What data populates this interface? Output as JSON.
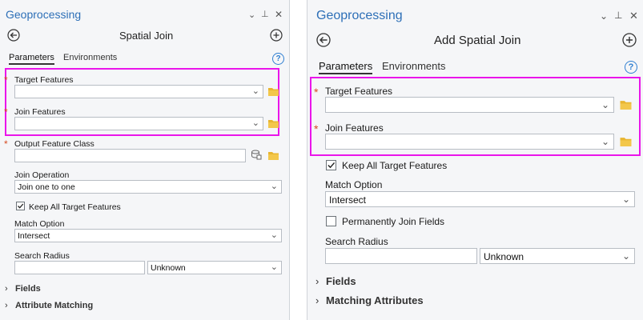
{
  "left": {
    "header": {
      "title": "Geoprocessing",
      "chevron": "⌄",
      "pin": "⊥",
      "close": "✕"
    },
    "tool": {
      "name": "Spatial Join"
    },
    "tabs": {
      "parameters": "Parameters",
      "environments": "Environments",
      "help": "?"
    },
    "target_features": {
      "label": "Target Features",
      "value": ""
    },
    "join_features": {
      "label": "Join Features",
      "value": ""
    },
    "output_feature_class": {
      "label": "Output Feature Class",
      "value": ""
    },
    "join_operation": {
      "label": "Join Operation",
      "value": "Join one to one"
    },
    "keep_all": {
      "label": "Keep All Target Features",
      "checked": true
    },
    "match_option": {
      "label": "Match Option",
      "value": "Intersect"
    },
    "search_radius": {
      "label": "Search Radius",
      "value": "",
      "unit": "Unknown"
    },
    "sections": {
      "fields": "Fields",
      "attribute_matching": "Attribute Matching"
    }
  },
  "right": {
    "header": {
      "title": "Geoprocessing",
      "chevron": "⌄",
      "pin": "⊥",
      "close": "✕"
    },
    "tool": {
      "name": "Add Spatial Join"
    },
    "tabs": {
      "parameters": "Parameters",
      "environments": "Environments",
      "help": "?"
    },
    "target_features": {
      "label": "Target Features",
      "value": ""
    },
    "join_features": {
      "label": "Join Features",
      "value": ""
    },
    "keep_all": {
      "label": "Keep All Target Features",
      "checked": true
    },
    "match_option": {
      "label": "Match Option",
      "value": "Intersect"
    },
    "permanently_join": {
      "label": "Permanently Join Fields",
      "checked": false
    },
    "search_radius": {
      "label": "Search Radius",
      "value": "",
      "unit": "Unknown"
    },
    "sections": {
      "fields": "Fields",
      "matching_attributes": "Matching Attributes"
    }
  },
  "colors": {
    "title_blue": "#2d6fb7",
    "highlight": "#ea15ea",
    "required_star": "#d64a20",
    "folder": "#e8b530",
    "panel_bg": "#f5f6f8"
  },
  "icons": {
    "back": "back-arrow-icon",
    "add": "plus-circle-icon",
    "folder": "folder-icon",
    "database": "geodatabase-icon"
  }
}
